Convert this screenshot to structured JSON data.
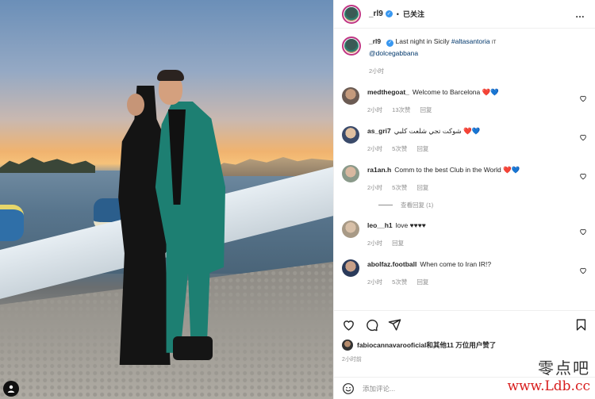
{
  "header": {
    "username": "_rl9",
    "verified_mark": "✓",
    "separator": "•",
    "follow_status": "已关注",
    "more": "…"
  },
  "caption": {
    "username": "_rl9",
    "text": "Last night in Sicily",
    "hashtag": "#altasantoria",
    "flag": "IT",
    "mention": "@dolcegabbana",
    "time": "2小时"
  },
  "comments": [
    {
      "username": "medthegoat_",
      "text": "Welcome to Barcelona",
      "emoji": "❤️💙",
      "time": "2小时",
      "likes": "13次赞",
      "reply": "回复",
      "avatar_color": "#6b5b53"
    },
    {
      "username": "as_gri7",
      "text": "شوكت تجي شلعت كلبي",
      "emoji": "❤️💙",
      "time": "2小时",
      "likes": "5次赞",
      "reply": "回复",
      "avatar_color": "#c9a88b"
    },
    {
      "username": "ra1an.h",
      "text": "Comm to the best Club in the World",
      "emoji": "❤️💙",
      "time": "2小时",
      "likes": "5次赞",
      "reply": "回复",
      "avatar_color": "#8a9a8a"
    },
    {
      "username": "leo__h1",
      "text": "love",
      "emoji": "♥♥♥♥",
      "time": "2小时",
      "likes": "",
      "reply": "回复",
      "avatar_color": "#a89a86"
    },
    {
      "username": "abolfaz.football",
      "text": "When come to Iran",
      "emoji": "IR!?",
      "time": "2小时",
      "likes": "5次赞",
      "reply": "回复",
      "avatar_color": "#2a3a5a"
    }
  ],
  "view_replies": "查看回复 (1)",
  "likes": {
    "user": "fabiocannavarooficial",
    "rest": "和其他11 万位用户赞了"
  },
  "post_time": "2小时前",
  "add_comment_placeholder": "添加评论...",
  "watermark": {
    "cn": "零点吧",
    "url": "www.Ldb.cc"
  },
  "colors": {
    "verified": "#3897f0",
    "link": "#00376b",
    "muted": "#8e8e8e",
    "suit": "#1d7f72"
  }
}
